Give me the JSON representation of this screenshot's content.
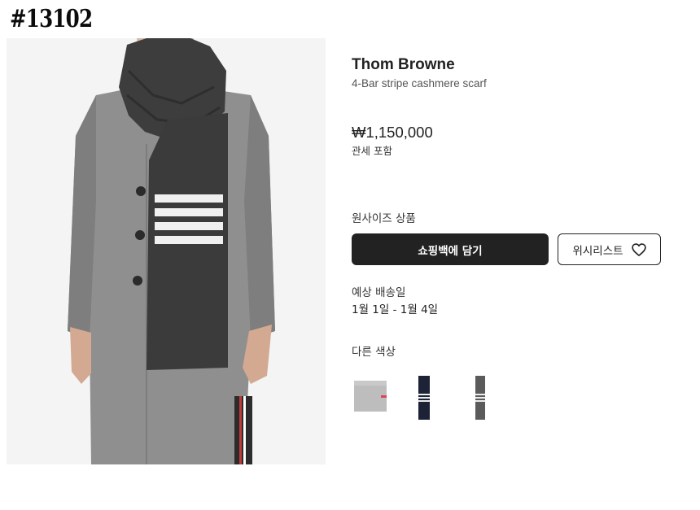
{
  "watermark": "#13102",
  "product": {
    "brand": "Thom Browne",
    "name": "4-Bar stripe cashmere scarf",
    "price": "₩1,150,000",
    "price_note": "관세 포함",
    "size_label": "원사이즈 상품",
    "add_to_bag_label": "쇼핑백에 담기",
    "wishlist_label": "위시리스트",
    "delivery_label": "예상 배송일",
    "delivery_date": "1월 1일 - 1월 4일",
    "other_colors_label": "다른 색상",
    "other_colors": [
      {
        "name": "light-grey",
        "color": "#bdbdbd"
      },
      {
        "name": "navy",
        "color": "#1d2236"
      },
      {
        "name": "dark-grey",
        "color": "#5b5b5b"
      }
    ]
  },
  "icons": {
    "wishlist": "heart-outline-icon"
  },
  "colors": {
    "primary_button": "#222222",
    "coat": "#8f8f8f",
    "scarf": "#3b3b3b",
    "stripe": "#f0f0f0",
    "background": "#ffffff"
  }
}
